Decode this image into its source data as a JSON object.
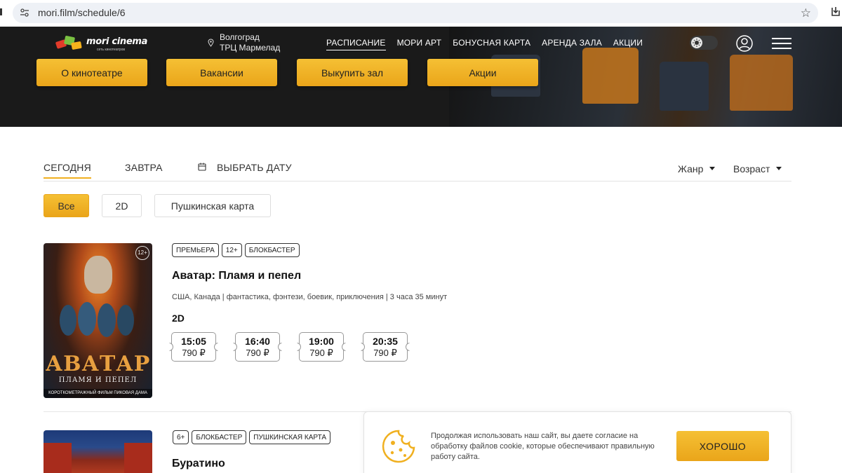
{
  "browser": {
    "url": "mori.film/schedule/6"
  },
  "header": {
    "logo_text": "mori cinema",
    "logo_sub": "сеть кинотеатров",
    "location": {
      "city": "Волгоград",
      "mall": "ТРЦ Мармелад"
    },
    "nav": [
      {
        "label": "РАСПИСАНИЕ",
        "active": true
      },
      {
        "label": "МОРИ АРТ"
      },
      {
        "label": "БОНУСНАЯ КАРТА"
      },
      {
        "label": "АРЕНДА ЗАЛА"
      },
      {
        "label": "АКЦИИ"
      }
    ],
    "hero_buttons": [
      "О кинотеатре",
      "Вакансии",
      "Выкупить зал",
      "Акции"
    ]
  },
  "date_tabs": [
    {
      "label": "СЕГОДНЯ",
      "active": true
    },
    {
      "label": "ЗАВТРА"
    },
    {
      "label": "ВЫБРАТЬ ДАТУ",
      "icon": "calendar-icon"
    }
  ],
  "filters": {
    "genre": "Жанр",
    "age": "Возраст"
  },
  "format_chips": [
    {
      "label": "Все",
      "active": true
    },
    {
      "label": "2D"
    },
    {
      "label": "Пушкинская карта"
    }
  ],
  "movies": [
    {
      "badges": [
        "ПРЕМЬЕРА",
        "12+",
        "БЛОКБАСТЕР"
      ],
      "title": "Аватар: Пламя и пепел",
      "meta": "США, Канада | фантастика, фэнтези, боевик, приключения | 3 часа 35 минут",
      "format": "2D",
      "poster": {
        "title": "АВАТАР",
        "subtitle": "ПЛАМЯ И ПЕПЕЛ",
        "footer": "КОРОТКОМЕТРАЖНЫЙ ФИЛЬМ ПИКОВАЯ ДАМА",
        "age": "12+"
      },
      "sessions": [
        {
          "time": "15:05",
          "price": "790 ₽"
        },
        {
          "time": "16:40",
          "price": "790 ₽"
        },
        {
          "time": "19:00",
          "price": "790 ₽"
        },
        {
          "time": "20:35",
          "price": "790 ₽"
        }
      ]
    },
    {
      "badges": [
        "6+",
        "БЛОКБАСТЕР",
        "ПУШКИНСКАЯ КАРТА"
      ],
      "title": "Буратино"
    }
  ],
  "cookie": {
    "text": "Продолжая использовать наш сайт, вы даете согласие на обработку файлов cookie, которые обеспечивают правильную работу сайта.",
    "button": "ХОРОШО"
  },
  "colors": {
    "accent": "#f0b020",
    "header_bg": "#1a1a1a"
  }
}
